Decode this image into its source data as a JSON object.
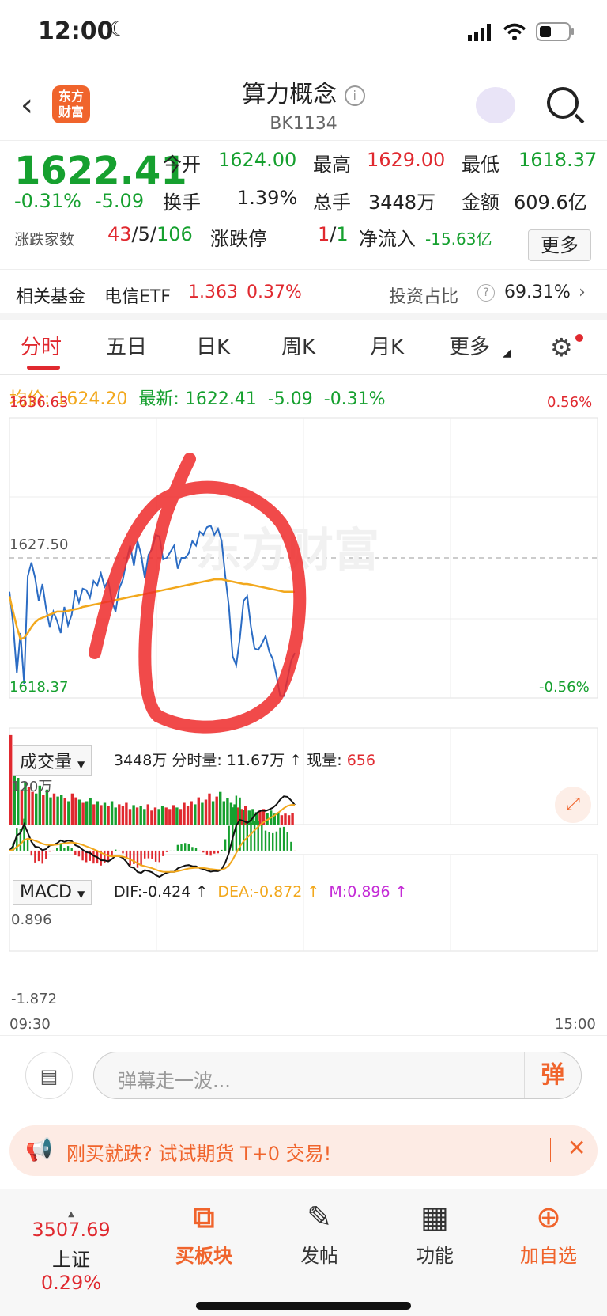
{
  "status": {
    "time": "12:00"
  },
  "header": {
    "title": "算力概念",
    "code": "BK1134",
    "logo_text": "东方财富"
  },
  "quote": {
    "price": "1622.41",
    "change_pct": "-0.31%",
    "change": "-5.09",
    "open_label": "今开",
    "open": "1624.00",
    "high_label": "最高",
    "high": "1629.00",
    "low_label": "最低",
    "low": "1618.37",
    "turnover_label": "换手",
    "turnover": "1.39%",
    "volume_label": "总手",
    "volume": "3448万",
    "amount_label": "金额",
    "amount": "609.6亿",
    "updown_label": "涨跌家数",
    "up": "43",
    "flat": "5",
    "down": "106",
    "limit_label": "涨跌停",
    "limit_up": "1",
    "limit_down": "1",
    "netflow_label": "净流入",
    "netflow": "-15.63亿",
    "more_label": "更多"
  },
  "fund": {
    "label": "相关基金",
    "name": "电信ETF",
    "price": "1.363",
    "pct": "0.37%",
    "ratio_label": "投资占比",
    "ratio": "69.31%"
  },
  "tabs": [
    "分时",
    "五日",
    "日K",
    "周K",
    "月K",
    "更多"
  ],
  "infoline": {
    "avg_label": "均价:",
    "avg": "1624.20",
    "latest_label": "最新:",
    "latest": "1622.41",
    "chg": "-5.09",
    "pct": "-0.31%"
  },
  "chart_labels": {
    "top": "1636.63",
    "mid": "1627.50",
    "bottom": "1618.37",
    "top_pct": "0.56%",
    "bottom_pct": "-0.56%",
    "watermark": "东方财富"
  },
  "volume": {
    "select": "成交量",
    "total": "3448万",
    "period_label": "分时量:",
    "period": "11.67万",
    "now_label": "现量:",
    "now": "656",
    "axis_max": "120万"
  },
  "macd": {
    "select": "MACD",
    "dif": "DIF:-0.424",
    "dea": "DEA:-0.872",
    "m": "M:0.896",
    "top": "0.896",
    "bottom": "-1.872"
  },
  "time_axis": {
    "start": "09:30",
    "end": "15:00"
  },
  "danmu": {
    "placeholder": "弹幕走一波...",
    "button": "弹"
  },
  "promo": {
    "text": "刚买就跌? 试试期货 T+0 交易!"
  },
  "bottom_nav": {
    "index_value": "3507.69",
    "index_name": "上证",
    "index_pct": "0.29%",
    "buy": "买板块",
    "post": "发帖",
    "func": "功能",
    "add": "加自选"
  },
  "colors": {
    "up": "#e0292f",
    "down": "#16a02f",
    "price_line": "#2b6cc4",
    "avg_line": "#f2a81d",
    "accent": "#f0642c"
  },
  "chart_data": {
    "type": "line",
    "ylim": [
      1618.37,
      1636.63
    ],
    "series": [
      {
        "values": [
          1625.3,
          1623.2,
          1620.0,
          1622.6,
          1619.3,
          1626.3,
          1627.2,
          1626.2,
          1624.7,
          1625.8,
          1624.2,
          1623.0,
          1624.0,
          1623.4,
          1622.6,
          1624.3,
          1623.1,
          1623.8,
          1625.4,
          1624.6,
          1625.5,
          1625.4,
          1624.9,
          1626.0,
          1625.7,
          1626.5,
          1625.6,
          1626.0,
          1624.7,
          1624.0,
          1625.5,
          1626.1,
          1627.3,
          1628.3,
          1627.0,
          1628.6,
          1627.7,
          1626.2,
          1627.7,
          1628.1,
          1629.0,
          1628.9,
          1627.4,
          1627.5,
          1627.9,
          1628.3,
          1626.8,
          1627.5,
          1627.5,
          1627.8,
          1628.6,
          1628.3,
          1629.2,
          1629.0,
          1629.5,
          1629.6,
          1629.0,
          1629.4,
          1628.6,
          1626.3,
          1624.3,
          1621.1,
          1620.5,
          1622.3,
          1624.7,
          1625.0,
          1623.0,
          1621.6,
          1621.5,
          1621.9,
          1622.4,
          1621.4,
          1620.9,
          1619.8,
          1618.5,
          1618.5,
          1619.6,
          1620.8,
          1621.3
        ]
      },
      {
        "values": [
          1625.0,
          1624.0,
          1623.0,
          1622.2,
          1622.3,
          1622.6,
          1623.0,
          1623.3,
          1623.5,
          1623.6,
          1623.7,
          1623.8,
          1623.9,
          1624.0,
          1624.0,
          1624.0,
          1624.05,
          1624.1,
          1624.15,
          1624.2,
          1624.3,
          1624.35,
          1624.4,
          1624.45,
          1624.5,
          1624.55,
          1624.6,
          1624.65,
          1624.7,
          1624.75,
          1624.8,
          1624.85,
          1624.9,
          1624.95,
          1625.0,
          1625.05,
          1625.1,
          1625.15,
          1625.2,
          1625.25,
          1625.3,
          1625.35,
          1625.4,
          1625.45,
          1625.5,
          1625.55,
          1625.6,
          1625.65,
          1625.7,
          1625.75,
          1625.8,
          1625.85,
          1625.9,
          1625.95,
          1626.0,
          1626.05,
          1626.1,
          1626.1,
          1626.1,
          1626.05,
          1626.0,
          1625.95,
          1625.9,
          1625.85,
          1625.8,
          1625.8,
          1625.75,
          1625.7,
          1625.65,
          1625.6,
          1625.55,
          1625.5,
          1625.45,
          1625.4,
          1625.35,
          1625.3,
          1625.3,
          1625.3,
          1625.3
        ]
      }
    ],
    "volume_values": [
      115,
      80,
      60,
      45,
      55,
      48,
      42,
      40,
      50,
      38,
      45,
      35,
      40,
      36,
      38,
      34,
      30,
      40,
      35,
      32,
      28,
      30,
      34,
      26,
      30,
      25,
      28,
      24,
      30,
      22,
      26,
      24,
      28,
      20,
      25,
      22,
      24,
      20,
      26,
      18,
      22,
      20,
      24,
      22,
      20,
      25,
      22,
      20,
      28,
      24,
      30,
      26,
      35,
      28,
      32,
      40,
      30,
      36,
      42,
      30,
      34,
      28,
      26,
      22,
      20,
      24,
      18,
      20,
      16,
      18,
      20,
      15,
      18,
      14,
      16,
      12,
      14,
      12,
      15
    ]
  }
}
